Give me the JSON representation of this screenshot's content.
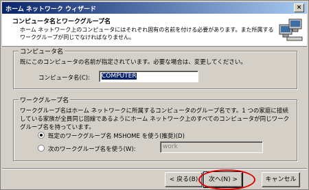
{
  "window": {
    "title": "ホーム ネットワーク ウィザード",
    "close_label": "×"
  },
  "header": {
    "title": "コンピュータ名とワークグループ名",
    "description": "ホーム ネットワーク上のコンピュータにはそれぞれ固有の名前を付ける必要があります。また所属するワークグループが同じでなければなりません。",
    "icon": "computers-icon"
  },
  "computer_name_group": {
    "label": "コンピュータ名",
    "description": "既にこのコンピュータの名前が指定されています。必要な場合は、変更してください。",
    "field_label": "コンピュータ名(C):",
    "field_value": "COMPUTER"
  },
  "workgroup_group": {
    "label": "ワークグループ名",
    "description": "ワークグループ名はホーム ネットワークに所属するコンピュータのグループ名です。1 つの家庭に接続している家族が全員同じ回線であるようにホーム ネットワーク上のすべてのコンピュータが同じワークグループ名を持っています。",
    "option_default": "既定のワークグループ名 MSHOME を使う(推奨)(D)",
    "option_custom": "次のワークグループ名を使う(W):",
    "custom_value": "work"
  },
  "buttons": {
    "back": "< 戻る(B)",
    "next": "次へ(N) >",
    "cancel": "キャンセル"
  },
  "annotation_color": "#e00000"
}
